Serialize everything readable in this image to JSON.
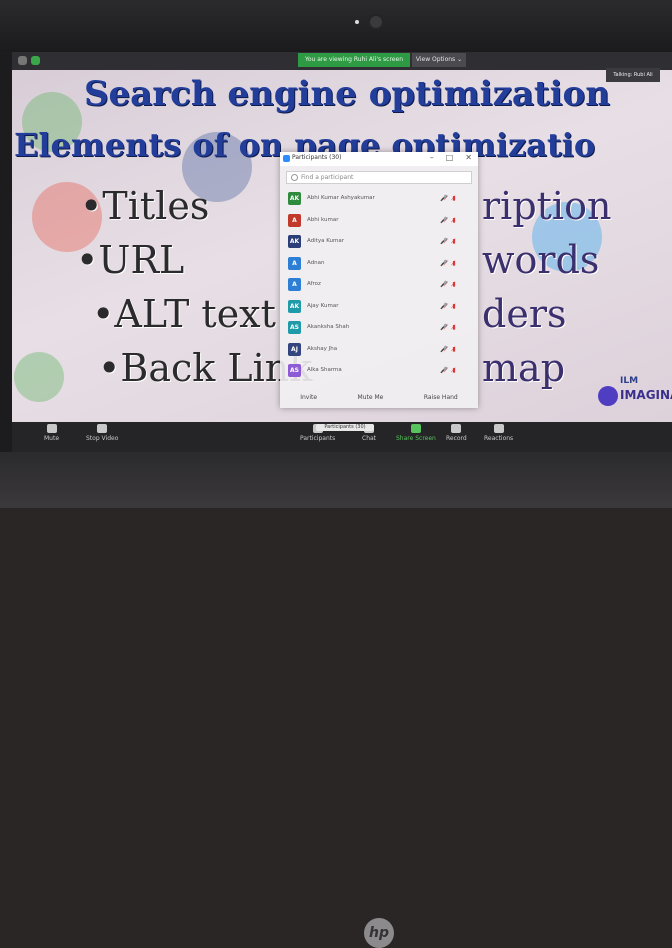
{
  "meeting": {
    "share_banner": "You are viewing Ruhi Ali's screen",
    "view_options": "View Options ⌄",
    "talking": "Talking: Rubi Ali"
  },
  "slide": {
    "title_line1": "Search engine optimization",
    "title_line2": "Elements of on page optimizatio",
    "bullets_left": [
      "•Titles",
      "•URL",
      "•ALT text",
      "•Back Link"
    ],
    "bullets_right": [
      "ription",
      "words",
      "ders",
      "map"
    ],
    "logo_line1": "ILM",
    "logo_line2": "IMAGINA"
  },
  "participants_panel": {
    "title": "Participants (30)",
    "controls": [
      "–",
      "□",
      "✕"
    ],
    "search_placeholder": "Find a participant",
    "participants": [
      {
        "initials": "AK",
        "name": "Abhi Kumar Ashyakumar",
        "color": "#2e8b3e"
      },
      {
        "initials": "A",
        "name": "Abhi kumar",
        "color": "#c0392b"
      },
      {
        "initials": "AK",
        "name": "Aditya Kumar",
        "color": "#2c3e7a"
      },
      {
        "initials": "A",
        "name": "Adnan",
        "color": "#2d7fd6"
      },
      {
        "initials": "A",
        "name": "Afroz",
        "color": "#2d7fd6"
      },
      {
        "initials": "AK",
        "name": "Ajay Kumar",
        "color": "#1f9aa8"
      },
      {
        "initials": "AS",
        "name": "Akanksha Shah",
        "color": "#1f9aa8"
      },
      {
        "initials": "AJ",
        "name": "Akshay Jha",
        "color": "#34447e"
      },
      {
        "initials": "AS",
        "name": "Alka Sharma",
        "color": "#8e5bd6"
      }
    ],
    "row_icons": "🎤̸ ▮̸",
    "footer": {
      "invite": "Invite",
      "mute_me": "Mute Me",
      "raise_hand": "Raise Hand"
    }
  },
  "toolbar": {
    "mute": "Mute",
    "stop_video": "Stop Video",
    "participants": "Participants",
    "chat": "Chat",
    "share_screen": "Share Screen",
    "record": "Record",
    "reactions": "Reactions",
    "notification": "Participants (30)"
  },
  "laptop": {
    "logo": "hp"
  },
  "colors": {
    "title_blue": "#233e9a",
    "zoom_green": "#2e9a43",
    "toolbar_bg": "#252527"
  }
}
